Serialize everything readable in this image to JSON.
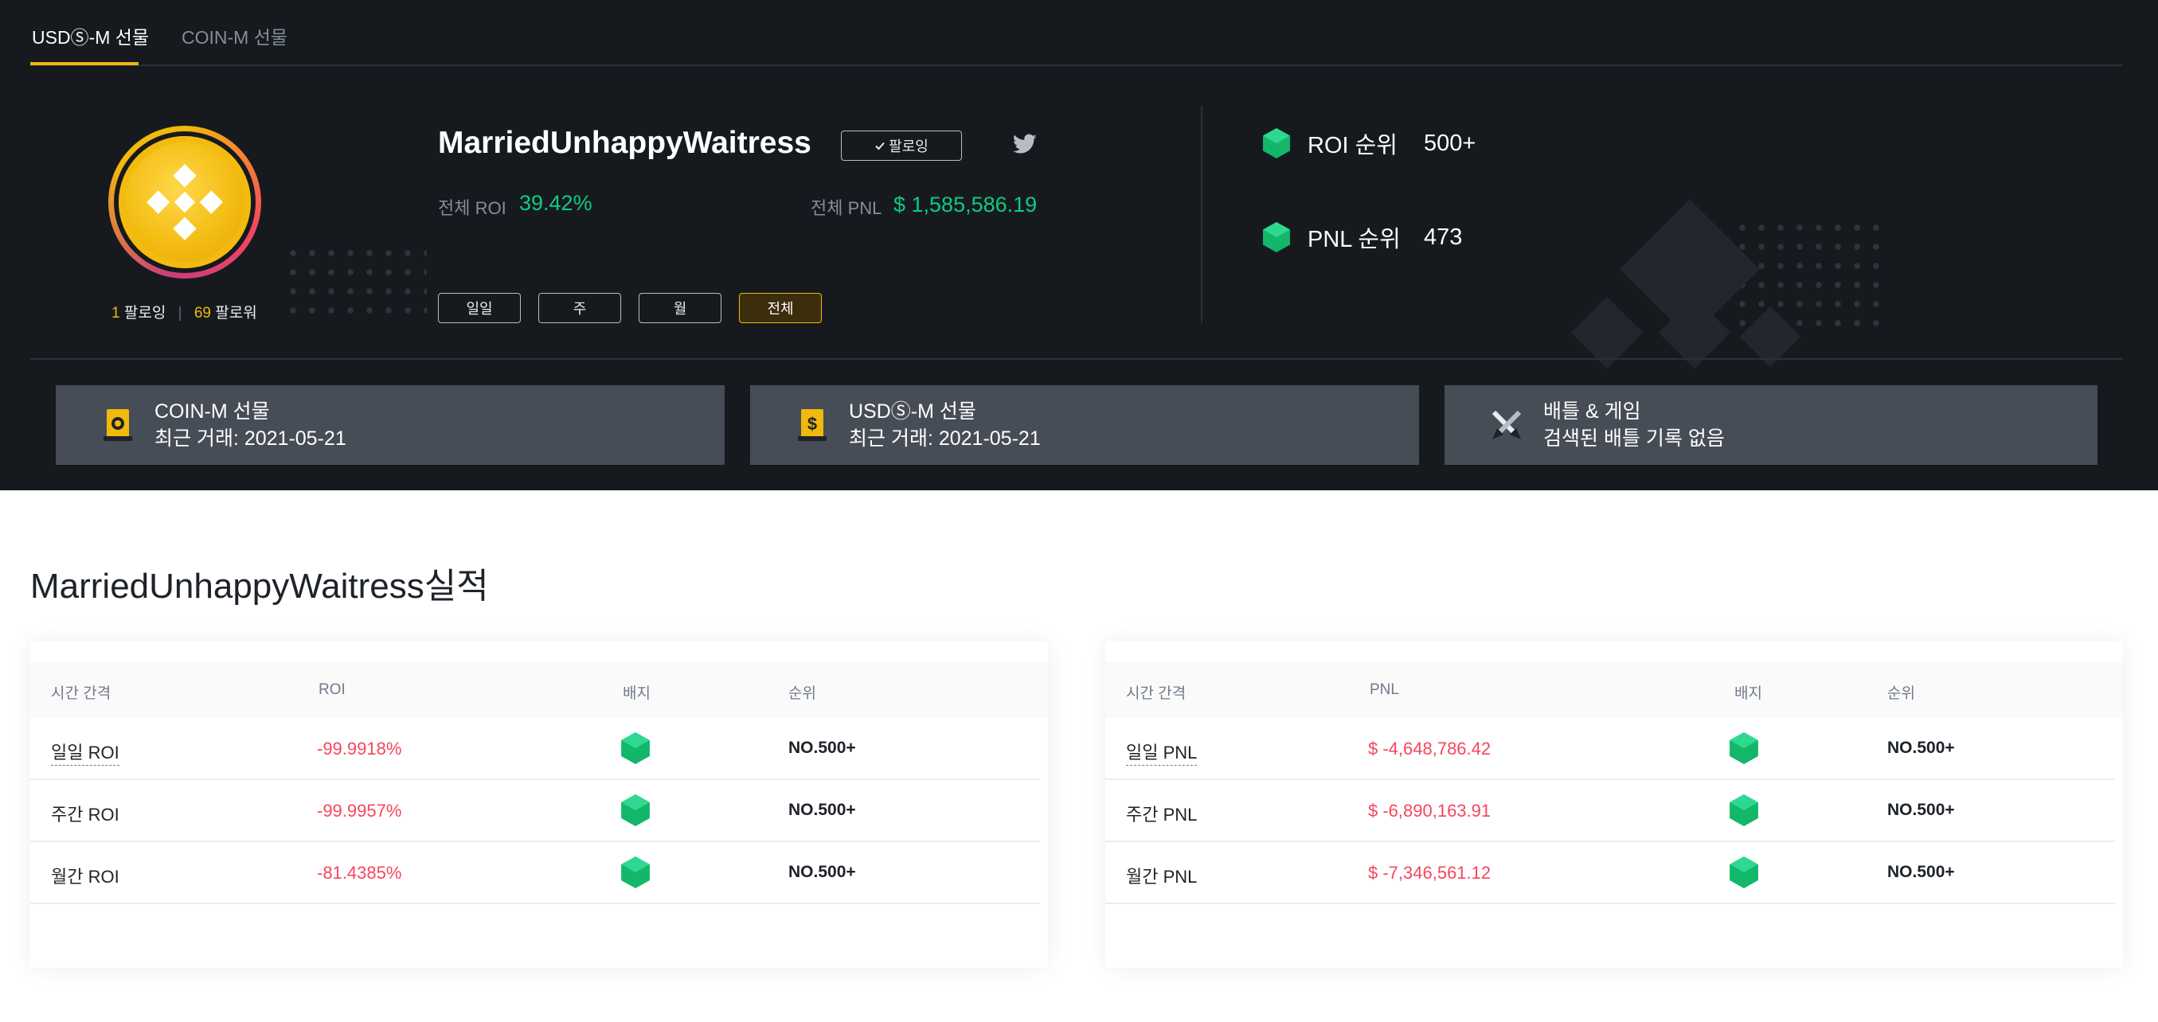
{
  "tabs": [
    {
      "label": "USDⓈ-M 선물",
      "active": true
    },
    {
      "label": "COIN-M 선물",
      "active": false
    }
  ],
  "profile": {
    "username": "MarriedUnhappyWaitress",
    "follow_button": "팔로잉",
    "following_count": "1",
    "following_label": "팔로잉",
    "followers_count": "69",
    "followers_label": "팔로워",
    "roi_label": "전체 ROI",
    "roi_value": "39.42%",
    "pnl_label": "전체 PNL",
    "pnl_value": "$ 1,585,586.19",
    "periods": [
      "일일",
      "주",
      "월",
      "전체"
    ],
    "active_period": "전체"
  },
  "ranks": [
    {
      "label": "ROI 순위",
      "value": "500+"
    },
    {
      "label": "PNL 순위",
      "value": "473"
    }
  ],
  "cards": [
    {
      "title": "COIN-M 선물",
      "subtitle": "최근 거래: 2021-05-21",
      "icon": "coin-m-futures-icon"
    },
    {
      "title": "USDⓈ-M 선물",
      "subtitle": "최근 거래: 2021-05-21",
      "icon": "usds-m-futures-icon"
    },
    {
      "title": "배틀 & 게임",
      "subtitle": "검색된 배틀 기록 없음",
      "icon": "battle-swords-icon"
    }
  ],
  "performance": {
    "title": "MarriedUnhappyWaitress실적",
    "roi_table": {
      "headers": [
        "시간 간격",
        "ROI",
        "배지",
        "순위"
      ],
      "rows": [
        {
          "label": "일일 ROI",
          "value": "-99.9918%",
          "rank": "NO.500+"
        },
        {
          "label": "주간 ROI",
          "value": "-99.9957%",
          "rank": "NO.500+"
        },
        {
          "label": "월간 ROI",
          "value": "-81.4385%",
          "rank": "NO.500+"
        }
      ]
    },
    "pnl_table": {
      "headers": [
        "시간 간격",
        "PNL",
        "배지",
        "순위"
      ],
      "rows": [
        {
          "label": "일일 PNL",
          "value": "$ -4,648,786.42",
          "rank": "NO.500+"
        },
        {
          "label": "주간 PNL",
          "value": "$ -6,890,163.91",
          "rank": "NO.500+"
        },
        {
          "label": "월간 PNL",
          "value": "$ -7,346,561.12",
          "rank": "NO.500+"
        }
      ]
    }
  },
  "colors": {
    "accent": "#f0b90b",
    "positive": "#0ecb81",
    "negative": "#f6465d",
    "badge": "#12b76a"
  }
}
